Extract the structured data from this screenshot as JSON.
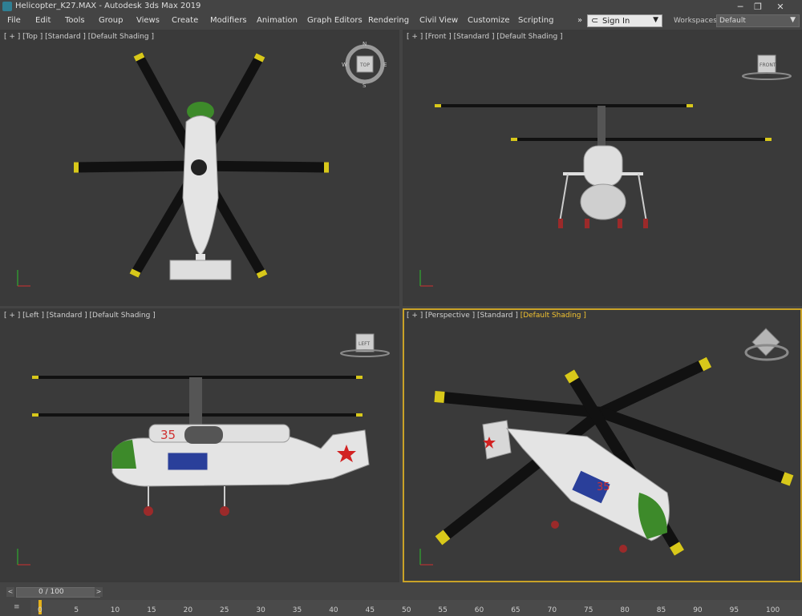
{
  "window": {
    "title": "Helicopter_K27.MAX - Autodesk 3ds Max 2019",
    "minimize": "─",
    "maximize": "❐",
    "close": "✕"
  },
  "menu": [
    "File",
    "Edit",
    "Tools",
    "Group",
    "Views",
    "Create",
    "Modifiers",
    "Animation",
    "Graph Editors",
    "Rendering",
    "Civil View",
    "Customize",
    "Scripting"
  ],
  "menu_more": "»",
  "signin": {
    "label": "Sign In",
    "icon": "user-icon"
  },
  "workspaces": {
    "label": "Workspaces:",
    "value": "Default"
  },
  "viewports": {
    "top": {
      "l1": "[ + ] [Top ] [Standard ] [Default Shading ]",
      "cube": "TOP",
      "compass": {
        "n": "N",
        "s": "S",
        "e": "E",
        "w": "W"
      }
    },
    "front": {
      "l1": "[ + ] [Front ] [Standard ] [Default Shading ]",
      "cube": "FRONT"
    },
    "left": {
      "l1": "[ + ] [Left ] [Standard ] [Default Shading ]",
      "cube": "LEFT"
    },
    "persp": {
      "l1": "[ + ] [Perspective ] [Standard ] ",
      "l2": "[Default Shading ]",
      "cube": ""
    }
  },
  "helicopter": {
    "number": "35"
  },
  "colors": {
    "accent": "#c9a227",
    "viewport_bg": "#3a3a3a",
    "ui_bg": "#444444",
    "green": "#3d8a2a",
    "star": "#d22222"
  },
  "timeline": {
    "frame_label": "0 / 100",
    "prev": "<",
    "next": ">",
    "ticks": [
      "0",
      "5",
      "10",
      "15",
      "20",
      "25",
      "30",
      "35",
      "40",
      "45",
      "50",
      "55",
      "60",
      "65",
      "70",
      "75",
      "80",
      "85",
      "90",
      "95",
      "100"
    ]
  }
}
